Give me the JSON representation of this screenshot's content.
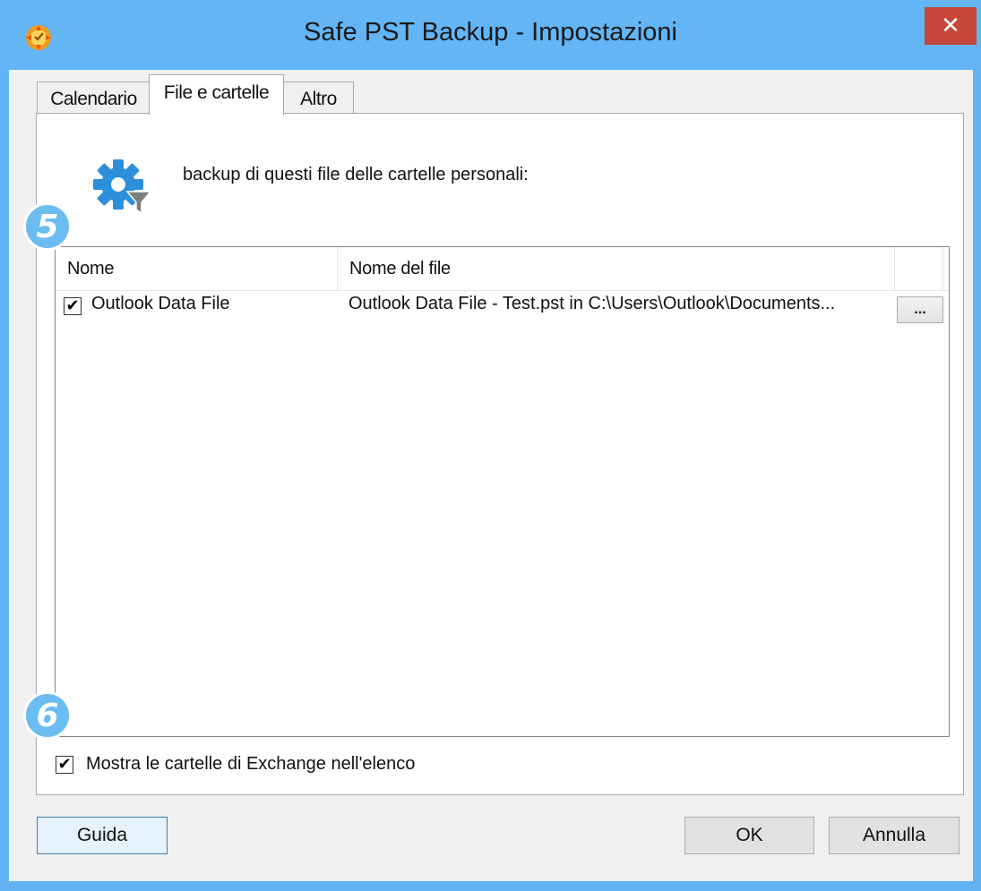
{
  "window": {
    "title": "Safe PST Backup - Impostazioni",
    "close_glyph": "✕"
  },
  "tabs": [
    {
      "label": "Calendario",
      "active": false
    },
    {
      "label": "File e cartelle",
      "active": true
    },
    {
      "label": "Altro",
      "active": false
    }
  ],
  "panel": {
    "intro_text": "backup di questi file delle cartelle personali:",
    "badge_list": "5",
    "badge_option": "6"
  },
  "list": {
    "columns": [
      "Nome",
      "Nome del file"
    ],
    "rows": [
      {
        "checked": true,
        "name": "Outlook Data File",
        "file": "Outlook Data File - Test.pst in C:\\Users\\Outlook\\Documents...",
        "browse_label": "..."
      }
    ]
  },
  "options": {
    "show_exchange_checked": true,
    "show_exchange_label": "Mostra le cartelle di Exchange nell'elenco"
  },
  "buttons": {
    "help": "Guida",
    "ok": "OK",
    "cancel": "Annulla"
  },
  "icons": {
    "app": "app-icon",
    "settings": "gear-filter-icon"
  },
  "colors": {
    "titlebar": "#63b5f6",
    "close": "#c7463b",
    "badge": "#6bbcf1"
  }
}
